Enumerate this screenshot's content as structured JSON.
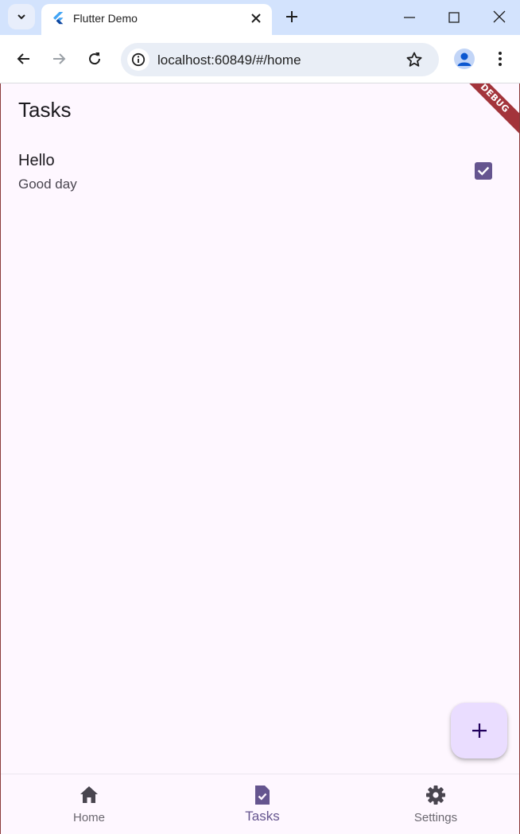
{
  "browser": {
    "tab_title": "Flutter Demo",
    "url": "localhost:60849/#/home"
  },
  "app": {
    "title": "Tasks",
    "debug_banner": "DEBUG",
    "tasks": [
      {
        "title": "Hello",
        "subtitle": "Good day",
        "checked": true
      }
    ],
    "bottom_nav": {
      "items": [
        {
          "label": "Home",
          "icon": "home-icon",
          "active": false
        },
        {
          "label": "Tasks",
          "icon": "task-icon",
          "active": true
        },
        {
          "label": "Settings",
          "icon": "settings-icon",
          "active": false
        }
      ]
    }
  },
  "colors": {
    "accent": "#65558f",
    "fab_bg": "#eaddff",
    "app_bg": "#fef7ff",
    "debug_banner": "#a3343b"
  }
}
